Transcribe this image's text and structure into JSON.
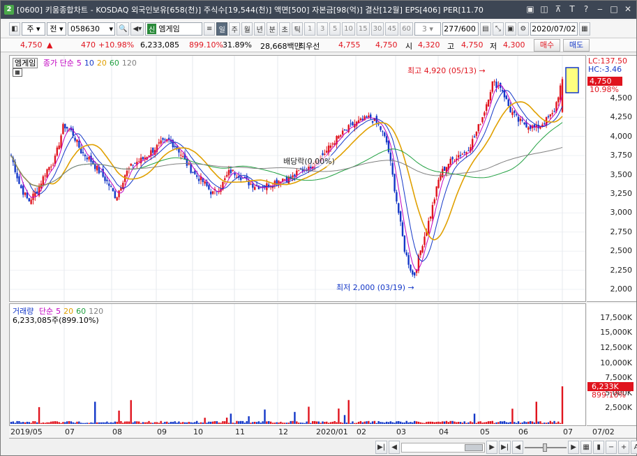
{
  "title": {
    "icon_text": "2",
    "text": "[0600] 키움종합차트 - KOSDAQ 외국인보유[658(천)] 주식수[19,544(천)] 액면[500] 자본금[98(억)] 결산[12월] EPS[406] PER[11.70"
  },
  "toolbar": {
    "market": "주",
    "period_type": "전",
    "code": "058630",
    "name_badge": "신",
    "name": "엠게임",
    "period_buttons": [
      "일",
      "주",
      "월",
      "년",
      "분",
      "초",
      "틱"
    ],
    "interval_buttons": [
      "1",
      "3",
      "5",
      "10",
      "15",
      "30",
      "45",
      "60"
    ],
    "interval_value": "3",
    "count": "277/600",
    "date": "2020/07/02"
  },
  "quote": {
    "price": "4,750",
    "arrow": "▲",
    "change": "470",
    "change_pct": "+10.98%",
    "volume": "6,233,085",
    "vol_ratio": "899.10%",
    "turnover": "31.89%",
    "amount": "28,668백만",
    "label_bid": "최우선",
    "bid1": "4,755",
    "bid2": "4,750",
    "open_label": "시",
    "open": "4,320",
    "high_label": "고",
    "high": "4,750",
    "low_label": "저",
    "low": "4,300",
    "buy": "매수",
    "sell": "매도"
  },
  "price_pane": {
    "tag": "엠게임",
    "legend_title": "종가 단순",
    "ma": [
      "5",
      "10",
      "20",
      "60",
      "120"
    ],
    "high_note": "최고 4,920 (05/13)",
    "low_note": "최저 2,000 (03/19)",
    "dividend_note": "배당락(0.00%)"
  },
  "price_axis": {
    "lc": "LC:137.50",
    "hc": "HC:-3.46",
    "cur_price": "4,750",
    "cur_pct": "10.98%",
    "ticks": [
      "4,500",
      "4,250",
      "4,000",
      "3,750",
      "3,500",
      "3,250",
      "3,000",
      "2,750",
      "2,500",
      "2,250",
      "2,000"
    ]
  },
  "volume_pane": {
    "tag": "거래량",
    "legend_title": "단순",
    "ma": [
      "5",
      "20",
      "60",
      "120"
    ],
    "value": "6,233,085주(899.10%)"
  },
  "volume_axis": {
    "ticks": [
      "17,500K",
      "15,000K",
      "12,500K",
      "10,000K",
      "7,500K",
      "5,000K",
      "2,500K"
    ],
    "cur_vol": "6,233K",
    "cur_pct": "899.10%"
  },
  "x_axis": {
    "labels": [
      "2019/05",
      "07",
      "08",
      "09",
      "10",
      "11",
      "12",
      "2020/01",
      "02",
      "03",
      "04",
      "05",
      "06",
      "07"
    ],
    "end_label": "07/02"
  },
  "colors": {
    "up": "#e0141e",
    "down": "#1438c8",
    "ma5": "#c000c0",
    "ma10": "#1438c8",
    "ma20": "#e0a000",
    "ma60": "#20a040",
    "ma120": "#808080"
  },
  "chart_data": {
    "type": "candlestick",
    "ylim": [
      1900,
      5000
    ],
    "vol_ylim": [
      0,
      18500000
    ],
    "annotations": {
      "high": {
        "value": 4920,
        "date": "05/13"
      },
      "low": {
        "value": 2000,
        "date": "03/19"
      }
    },
    "last": {
      "open": 4320,
      "high": 4750,
      "low": 4300,
      "close": 4750,
      "volume": 6233085
    },
    "approx_close_path": [
      3750,
      3350,
      3150,
      3300,
      3550,
      3700,
      4150,
      4050,
      3800,
      3700,
      3550,
      3400,
      3200,
      3500,
      3650,
      3700,
      3800,
      3900,
      3950,
      3850,
      3650,
      3500,
      3400,
      3250,
      3350,
      3550,
      3500,
      3400,
      3350,
      3350,
      3400,
      3450,
      3450,
      3550,
      3600,
      3700,
      3800,
      3950,
      4050,
      4150,
      4200,
      4250,
      4150,
      3900,
      3200,
      2500,
      2150,
      2600,
      3000,
      3500,
      3650,
      3750,
      3800,
      4000,
      4300,
      4700,
      4650,
      4350,
      4200,
      4150,
      4100,
      4200,
      4300,
      4750
    ]
  }
}
